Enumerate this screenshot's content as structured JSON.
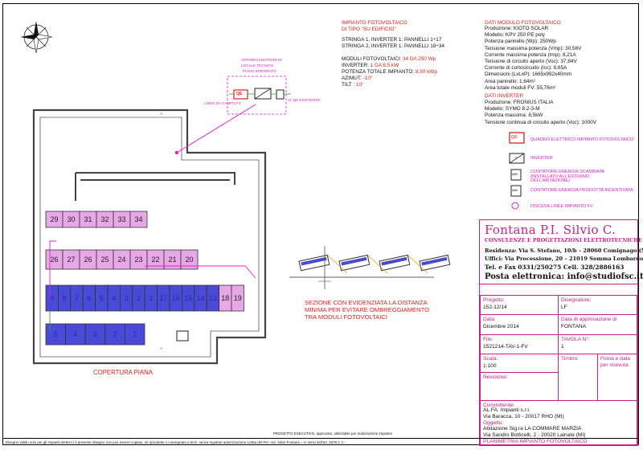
{
  "plant": {
    "title_line1": "IMPIANTO FOTOVOLTAICO",
    "title_line2": "DI TIPO \"SU EDIFICIO\"",
    "string1": "STRINGA 1, INVERTER 1: PANNELLI  1÷17",
    "string2": "STRINGA 2, INVERTER 1: PANNELLI 18÷34",
    "modules_label": "MODULI FOTOVOLTAICI:",
    "modules_value": "34 DA 250 Wp",
    "inverter_label": "INVERTER:",
    "inverter_value": "1 DA 8,5 kW",
    "power_label": "POTENZA TOTALE IMPIANTO:",
    "power_value": "8,50 kWp",
    "azimut_label": "AZIMUT:",
    "azimut_value": "-10°",
    "tilt_label": "TILT :",
    "tilt_value": "10°"
  },
  "module_data": {
    "title": "DATI MODULO FOTOVOLTAICO",
    "lines": [
      "Produzione: KIOTO SOLAR",
      "Modello: KPV 250 PE poly",
      "Potenza pannello (Wp): 250Wp",
      "Tensione massima potenza (Vmp): 30,56V",
      "Corrente massima potenza (Imp): 8,21A",
      "Tensione di circuito aperto (Voc): 37,84V",
      "Corrente di cortocircuito (Isc): 8,65A",
      "Dimensioni (LxLxP): 1665x992x40mm",
      "Area pannello: 1,64m²",
      "Area totale moduli FV: 55,76m²"
    ]
  },
  "inverter_data": {
    "title": "DATI INVERTER",
    "lines": [
      "Produzione: FRONIUS ITALIA",
      "Modello: SYMO 8.2-3-M",
      "Potenza massima: 8,5kW",
      "Tensione continua di circuito aperto (Voc): 1000V"
    ]
  },
  "legend": [
    {
      "symbol": "QE",
      "label": "QUADRO ELETTRICO IMPIANTO FOTOVOLTAICO"
    },
    {
      "symbol": "~",
      "label": "INVERTER"
    },
    {
      "symbol": "kWh",
      "label": "CONTATORE ENERGIA SCAMBIATA (INSTALLATO ALL'ESTERNO DELL'ABITAZIONE)"
    },
    {
      "symbol": "kWh",
      "label": "CONTATORE ENERGIA PRODOTTA INCENTIVATA"
    },
    {
      "symbol": "",
      "label": "DISCESA LINEE IMPIANTO FV"
    }
  ],
  "detail": {
    "label_left": "LINEE DA CAMPO FV",
    "label_top1": "APPARECCHIATURE DI",
    "label_top2": "LOCALE TECNICO",
    "label_top3": "PIANO INTERRATO",
    "label_right": "AL QE ESISTENTE",
    "qe_symbol": "QE"
  },
  "roof": {
    "label": "COPERTURA PIANA",
    "row_top": [
      "29",
      "30",
      "31",
      "32",
      "33",
      "34"
    ],
    "row_second": [
      "26",
      "27",
      "26",
      "25",
      "24",
      "23",
      "22",
      "21",
      "20"
    ],
    "row_third": [
      "9",
      "8",
      "7",
      "6",
      "5",
      "4",
      "3",
      "2",
      "1",
      "17",
      "16",
      "15",
      "14",
      "13",
      "18",
      "19"
    ],
    "row_bottom": [
      "5",
      "4",
      "3",
      "2",
      "1"
    ],
    "section_marker": "A"
  },
  "section": {
    "caption_line1": "SEZIONE CON EVIDENZIATA LA DISTANZA",
    "caption_line2": "MINIMA PER EVITARE OMBREGGIAMENTO",
    "caption_line3": "TRA MODULI FOTOVOLTAICI"
  },
  "firm": {
    "name": "Fontana P.I. Silvio C.",
    "subtitle": "CONSULENZE E PROGETTAZIONI ELETTROTECNICHE",
    "address1": "Residenza: Via S. Stefano, 10/b – 28060 Comignago (NO)",
    "address2": "Uffici: Via Processione, 20 – 21019 Somma Lombardo (Va)",
    "phone": "Tel. e Fax 0331/250275 Cell. 328/2886163",
    "email": "Posta elettronica: info@studiofsc.it"
  },
  "titleblock": {
    "progetto_label": "Progetto:",
    "progetto": "152-12/14",
    "disegnatore_label": "Disegnatore:",
    "disegnatore": "LF",
    "data_label": "Data:",
    "data": "Dicembre 2014",
    "approvazione_label": "Data di approvazione di",
    "approvazione": "FONTANA",
    "file_label": "File:",
    "file": "1521214-TAV-1-FV",
    "tavola_label": "TAVOLA N°:",
    "tavola": "1",
    "scala_label": "Scala:",
    "scala": "1:100",
    "timbro_label": "Timbro:",
    "firma_label1": "Firma e data",
    "firma_label2": "per ricevuta:",
    "revisione_label": "Revisione:",
    "committente_label": "Committente:",
    "committente1": "AL.FA. Impianti s.r.l.",
    "committente2": "Via Baracca, 10 - 20017 RHO (MI)",
    "oggetto_label": "Oggetto:",
    "oggetto1": "Abitazione Sig.ra LA COMMARE MARZIA",
    "oggetto2": "Via Sandro Botticelli, 2 - 20020 Lainate (MI)",
    "oggetto3": "PLANIMETRIA IMPIANTO FOTOVOLTAICO"
  },
  "footer": {
    "left": "Disegno valido solo per gli impianti elettrici | Il presente disegno non può essere copiato, né riprodotto o consegnato a terzi, senza regolare autorizzazione scritta del Per. Ind. Silvio Fontana – Ai sensi dell'art. 2575 C.C.",
    "stamp": "PROGETTO ESECUTIVO, approvato, utilizzabile per realizzazione impianto"
  }
}
